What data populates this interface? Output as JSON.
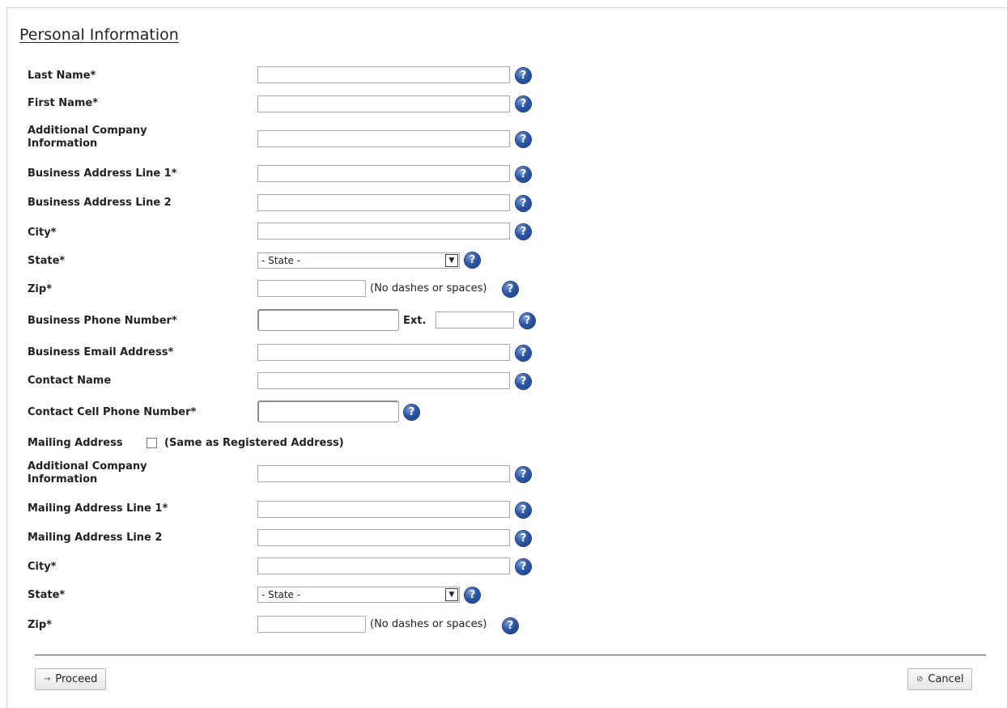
{
  "page": {
    "title": "Personal Information"
  },
  "fields": {
    "last_name": {
      "label": "Last Name*",
      "value": ""
    },
    "first_name": {
      "label": "First Name*",
      "value": ""
    },
    "addl_company_1": {
      "label_line1": "Additional Company",
      "label_line2": "Information",
      "value": ""
    },
    "bus_addr_1": {
      "label": "Business Address Line 1*",
      "value": ""
    },
    "bus_addr_2": {
      "label": "Business Address Line 2",
      "value": ""
    },
    "city_1": {
      "label": "City*",
      "value": ""
    },
    "state_1": {
      "label": "State*",
      "selected": "- State -"
    },
    "zip_1": {
      "label": "Zip*",
      "value": "",
      "hint": "(No dashes or spaces)"
    },
    "bus_phone": {
      "label": "Business Phone Number*",
      "value": "",
      "ext_label": "Ext.",
      "ext_value": ""
    },
    "bus_email": {
      "label": "Business Email Address*",
      "value": ""
    },
    "contact_name": {
      "label": "Contact Name",
      "value": ""
    },
    "contact_cell": {
      "label": "Contact Cell Phone Number*",
      "value": ""
    },
    "mailing": {
      "label": "Mailing Address",
      "checkbox_label": "(Same as Registered Address)",
      "checked": false
    },
    "addl_company_2": {
      "label_line1": "Additional Company",
      "label_line2": "Information",
      "value": ""
    },
    "mail_addr_1": {
      "label": "Mailing Address Line 1*",
      "value": ""
    },
    "mail_addr_2": {
      "label": "Mailing Address Line 2",
      "value": ""
    },
    "city_2": {
      "label": "City*",
      "value": ""
    },
    "state_2": {
      "label": "State*",
      "selected": "- State -"
    },
    "zip_2": {
      "label": "Zip*",
      "value": "",
      "hint": "(No dashes or spaces)"
    }
  },
  "help_icon_glyph": "?",
  "buttons": {
    "proceed": {
      "label": "Proceed",
      "icon": "arrow-right-icon",
      "glyph": "→"
    },
    "cancel": {
      "label": "Cancel",
      "icon": "cancel-icon",
      "glyph": "⊘"
    }
  },
  "colors": {
    "help_icon": "#2c58a8"
  }
}
